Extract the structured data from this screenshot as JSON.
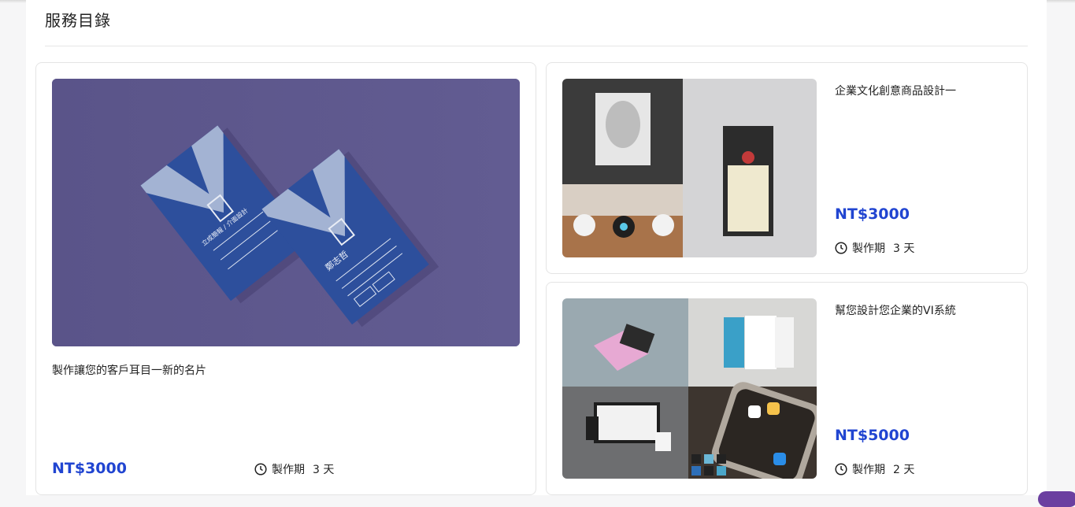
{
  "section": {
    "title": "服務目錄"
  },
  "services": [
    {
      "title": "製作讓您的客戶耳目一新的名片",
      "price": "NT$3000",
      "duration_label": "製作期",
      "duration_value": "3 天",
      "image_icon": "business-card-mockup",
      "card_text": {
        "brand": "立成簡報 / 介面設計",
        "name": "鄭志哲"
      }
    },
    {
      "title": "企業文化創意商品設計一",
      "price": "NT$3000",
      "duration_label": "製作期",
      "duration_value": "3 天",
      "image_icon": "merchandise-collage"
    },
    {
      "title": "幫您設計您企業的VI系統",
      "price": "NT$5000",
      "duration_label": "製作期",
      "duration_value": "2 天",
      "image_icon": "vi-system-collage"
    }
  ],
  "colors": {
    "price": "#2145d1",
    "card_bg": "#5c568c",
    "business_card": "#2d4f9c"
  }
}
